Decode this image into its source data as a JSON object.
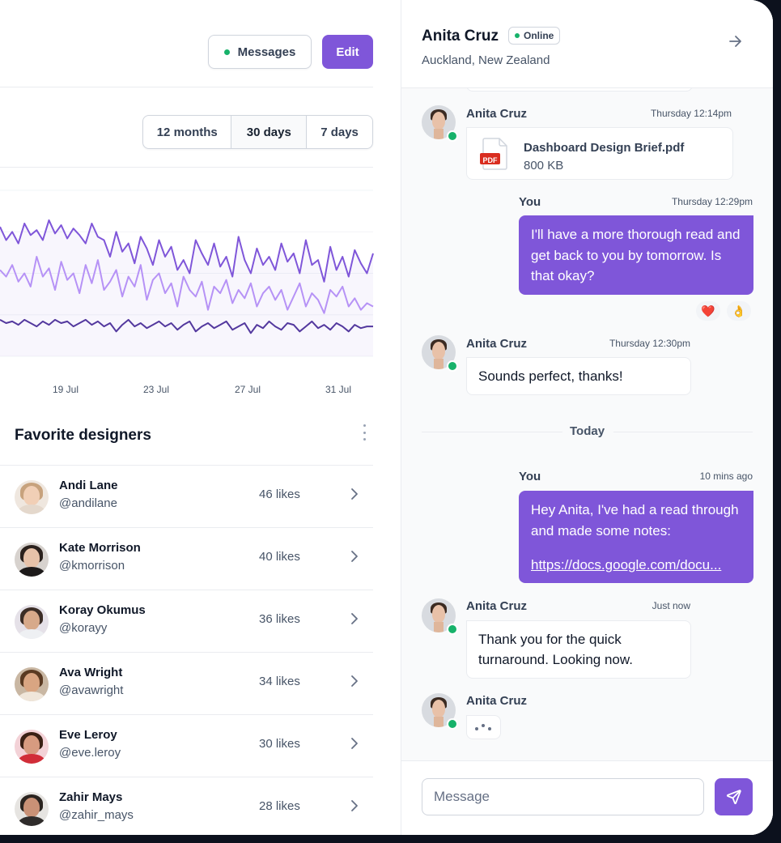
{
  "toolbar": {
    "messages_label": "Messages",
    "edit_label": "Edit"
  },
  "range": {
    "options": [
      "12 months",
      "30 days",
      "7 days"
    ],
    "selected": "30 days"
  },
  "chart_data": {
    "type": "line",
    "x_ticks": [
      "19 Jul",
      "23 Jul",
      "27 Jul",
      "31 Jul"
    ],
    "series": [
      {
        "color": "#7f56d9",
        "values": [
          78,
          70,
          75,
          68,
          80,
          73,
          76,
          70,
          82,
          74,
          79,
          71,
          77,
          73,
          68,
          80,
          72,
          70,
          60,
          75,
          63,
          68,
          56,
          72,
          65,
          55,
          70,
          60,
          66,
          52,
          58,
          50,
          70,
          62,
          55,
          68,
          54,
          60,
          48,
          72,
          58,
          50,
          65,
          55,
          60,
          52,
          68,
          57,
          62,
          50,
          70,
          55,
          58,
          45,
          66,
          52,
          60,
          48,
          64,
          56,
          50,
          62
        ]
      },
      {
        "color": "#b692f6",
        "values": [
          52,
          48,
          55,
          45,
          50,
          42,
          60,
          48,
          53,
          40,
          57,
          46,
          50,
          38,
          55,
          44,
          58,
          40,
          45,
          52,
          36,
          48,
          42,
          55,
          34,
          46,
          50,
          38,
          44,
          30,
          48,
          40,
          36,
          45,
          28,
          42,
          38,
          46,
          32,
          40,
          35,
          44,
          30,
          38,
          42,
          34,
          40,
          28,
          36,
          44,
          30,
          38,
          34,
          26,
          40,
          36,
          42,
          30,
          35,
          28,
          32,
          30
        ]
      },
      {
        "color": "#53389e",
        "values": [
          22,
          20,
          21,
          19,
          22,
          20,
          18,
          21,
          19,
          22,
          20,
          21,
          18,
          20,
          22,
          19,
          21,
          18,
          20,
          15,
          19,
          22,
          18,
          20,
          17,
          19,
          21,
          18,
          20,
          16,
          19,
          21,
          15,
          18,
          20,
          17,
          19,
          21,
          16,
          18,
          20,
          14,
          19,
          17,
          21,
          18,
          16,
          20,
          19,
          15,
          18,
          21,
          17,
          19,
          16,
          20,
          18,
          15,
          19,
          17,
          18,
          18
        ]
      }
    ],
    "ylim": [
      0,
      100
    ]
  },
  "favorites": {
    "title": "Favorite designers",
    "rows": [
      {
        "name": "Andi Lane",
        "handle": "@andilane",
        "likes": "46 likes",
        "hair": "#c7a27d",
        "skin": "#f1cfb6",
        "shirt": "#e4d8cc",
        "bg": "#efe7df"
      },
      {
        "name": "Kate Morrison",
        "handle": "@kmorrison",
        "likes": "40 likes",
        "hair": "#2b211d",
        "skin": "#e7c2a9",
        "shirt": "#1d1a1a",
        "bg": "#d7d2ce"
      },
      {
        "name": "Koray Okumus",
        "handle": "@korayy",
        "likes": "36 likes",
        "hair": "#3b2d26",
        "skin": "#d7a98a",
        "shirt": "#eef0f3",
        "bg": "#e5e1e8"
      },
      {
        "name": "Ava Wright",
        "handle": "@avawright",
        "likes": "34 likes",
        "hair": "#5a3a22",
        "skin": "#d9a582",
        "shirt": "#f0e6da",
        "bg": "#c9b7a3"
      },
      {
        "name": "Eve Leroy",
        "handle": "@eve.leroy",
        "likes": "30 likes",
        "hair": "#3a2014",
        "skin": "#d79b80",
        "shirt": "#d12d38",
        "bg": "#f3d2d7"
      },
      {
        "name": "Zahir Mays",
        "handle": "@zahir_mays",
        "likes": "28 likes",
        "hair": "#2b2420",
        "skin": "#c99176",
        "shirt": "#2f2c2b",
        "bg": "#e6e4e1"
      }
    ]
  },
  "chat": {
    "name": "Anita Cruz",
    "status": "Online",
    "location": "Auckland, New Zealand",
    "m1": {
      "sender": "Anita Cruz",
      "time": "Thursday 12:14pm",
      "file_name": "Dashboard Design Brief.pdf",
      "file_size": "800 KB",
      "file_badge": "PDF"
    },
    "m2": {
      "sender": "You",
      "time": "Thursday 12:29pm",
      "text": "I'll have a more thorough read and get back to you by tomorrow. Is that okay?",
      "reactions": [
        "❤️",
        "👌"
      ]
    },
    "m3": {
      "sender": "Anita Cruz",
      "time": "Thursday 12:30pm",
      "text": "Sounds perfect, thanks!"
    },
    "divider": "Today",
    "m4": {
      "sender": "You",
      "time": "10 mins ago",
      "text": "Hey Anita, I've had a read through and made some notes:",
      "link": "https://docs.google.com/docu..."
    },
    "m5": {
      "sender": "Anita Cruz",
      "time": "Just now",
      "text": "Thank you for the quick turnaround. Looking now."
    },
    "m6": {
      "sender": "Anita Cruz"
    },
    "input_placeholder": "Message"
  }
}
